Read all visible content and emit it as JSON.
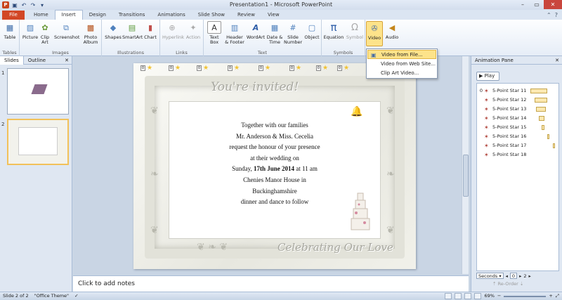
{
  "window": {
    "title": "Presentation1 - Microsoft PowerPoint"
  },
  "tabs": [
    {
      "label": "File"
    },
    {
      "label": "Home"
    },
    {
      "label": "Insert"
    },
    {
      "label": "Design"
    },
    {
      "label": "Transitions"
    },
    {
      "label": "Animations"
    },
    {
      "label": "Slide Show"
    },
    {
      "label": "Review"
    },
    {
      "label": "View"
    }
  ],
  "ribbon": {
    "groups": {
      "tables": "Tables",
      "images": "Images",
      "illustrations": "Illustrations",
      "links": "Links",
      "text": "Text",
      "symbols": "Symbols"
    },
    "buttons": {
      "table": "Table",
      "picture": "Picture",
      "clipart": "Clip Art",
      "screenshot": "Screenshot",
      "photoalbum": "Photo Album",
      "shapes": "Shapes",
      "smartart": "SmartArt",
      "chart": "Chart",
      "hyperlink": "Hyperlink",
      "action": "Action",
      "textbox": "Text Box",
      "headerfooter": "Header & Footer",
      "wordart": "WordArt",
      "datetime": "Date & Time",
      "slidenumber": "Slide Number",
      "object": "Object",
      "equation": "Equation",
      "symbol": "Symbol",
      "video": "Video",
      "audio": "Audio"
    }
  },
  "video_menu": {
    "items": [
      "Video from File...",
      "Video from Web Site...",
      "Clip Art Video..."
    ]
  },
  "left_panel": {
    "tabs": [
      "Slides",
      "Outline"
    ],
    "slide_numbers": [
      "1",
      "2"
    ]
  },
  "slide": {
    "script_top": "You're invited!",
    "script_bottom": "Celebrating Our Love",
    "lines": [
      "Together with our families",
      "Mr. Anderson & Miss. Cecelia",
      "request the honour of your presence",
      "at their wedding  on",
      "Chenies Manor House in",
      "Buckinghamshire",
      "dinner and dance to follow"
    ],
    "date_prefix": "Sunday, ",
    "date_bold": "17th June 2014",
    "date_suffix": " at 11 am",
    "markers": [
      "0",
      "0",
      "0",
      "0",
      "0",
      "0",
      "0",
      "0"
    ]
  },
  "notes": {
    "placeholder": "Click to add notes"
  },
  "animation_pane": {
    "title": "Animation Pane",
    "play": "Play",
    "items": [
      {
        "num": "0",
        "label": "5-Point Star 11"
      },
      {
        "num": "",
        "label": "5-Point Star 12"
      },
      {
        "num": "",
        "label": "5-Point Star 13"
      },
      {
        "num": "",
        "label": "5-Point Star 14"
      },
      {
        "num": "",
        "label": "5-Point Star 15"
      },
      {
        "num": "",
        "label": "5-Point Star 16"
      },
      {
        "num": "",
        "label": "5-Point Star 17"
      },
      {
        "num": "",
        "label": "5-Point Star 18"
      }
    ],
    "seconds": "Seconds",
    "timeline": [
      "0",
      "2"
    ],
    "reorder": "Re-Order"
  },
  "status": {
    "slide": "Slide 2 of 2",
    "theme": "\"Office Theme\"",
    "zoom": "69%"
  }
}
